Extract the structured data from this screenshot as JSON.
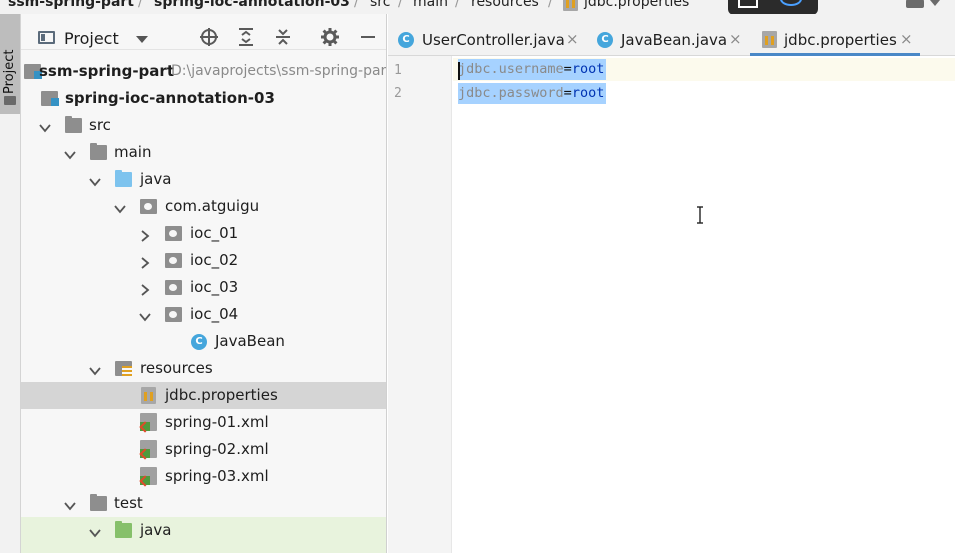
{
  "breadcrumb": {
    "items": [
      "ssm-spring-part",
      "spring-ioc-annotation-03",
      "src",
      "main",
      "resources",
      "jdbc.properties"
    ]
  },
  "left_strip": {
    "project_label": "Project"
  },
  "project_panel": {
    "title": "Project",
    "tree": [
      {
        "label": "ssm-spring-part",
        "path": "D:\\javaprojects\\ssm-spring-part",
        "icon": "module-icon"
      },
      {
        "label": "spring-ioc-annotation-03",
        "icon": "module-icon"
      },
      {
        "label": "src",
        "icon": "folder-icon"
      },
      {
        "label": "main",
        "icon": "folder-icon"
      },
      {
        "label": "java",
        "icon": "source-folder-icon"
      },
      {
        "label": "com.atguigu",
        "icon": "package-icon"
      },
      {
        "label": "ioc_01",
        "icon": "package-icon"
      },
      {
        "label": "ioc_02",
        "icon": "package-icon"
      },
      {
        "label": "ioc_03",
        "icon": "package-icon"
      },
      {
        "label": "ioc_04",
        "icon": "package-icon"
      },
      {
        "label": "JavaBean",
        "icon": "class-icon"
      },
      {
        "label": "resources",
        "icon": "resources-folder-icon"
      },
      {
        "label": "jdbc.properties",
        "icon": "properties-file-icon"
      },
      {
        "label": "spring-01.xml",
        "icon": "spring-xml-icon"
      },
      {
        "label": "spring-02.xml",
        "icon": "spring-xml-icon"
      },
      {
        "label": "spring-03.xml",
        "icon": "spring-xml-icon"
      },
      {
        "label": "test",
        "icon": "folder-icon"
      },
      {
        "label": "java",
        "icon": "test-source-folder-icon"
      }
    ]
  },
  "tabs": [
    {
      "label": "UserController.java",
      "icon": "class-icon",
      "close": "×"
    },
    {
      "label": "JavaBean.java",
      "icon": "class-icon",
      "close": "×"
    },
    {
      "label": "jdbc.properties",
      "icon": "properties-file-icon",
      "close": "×",
      "active": true
    }
  ],
  "editor": {
    "lines": [
      {
        "number": "1",
        "key": "jdbc.username",
        "eq": "=",
        "value": "root"
      },
      {
        "number": "2",
        "key": "jdbc.password",
        "eq": "=",
        "value": "root"
      }
    ]
  },
  "colors": {
    "selection": "#a6d2ff",
    "active_tab_underline": "#4a88c7",
    "class_icon": "#45a6dc",
    "source_folder": "#7dc3ee",
    "test_folder": "#86c06a"
  }
}
